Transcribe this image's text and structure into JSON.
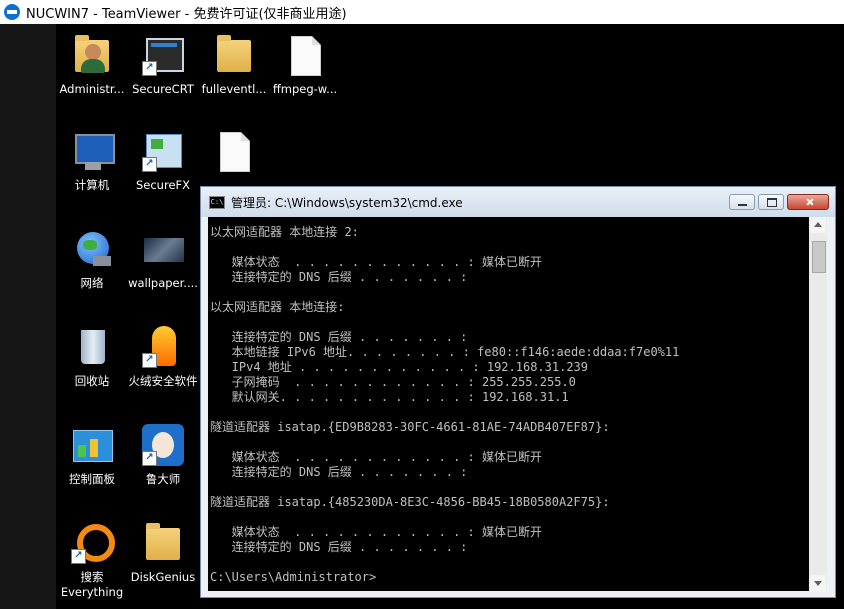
{
  "teamviewer": {
    "title": "NUCWIN7 - TeamViewer - 免费许可证(仅非商业用途)"
  },
  "desktop": {
    "icons": [
      {
        "label": "Administr...",
        "icon": "user-folder-icon"
      },
      {
        "label": "SecureCRT",
        "icon": "securecrt-icon"
      },
      {
        "label": "fulleventl...",
        "icon": "folder-icon"
      },
      {
        "label": "ffmpeg-w...",
        "icon": "document-icon"
      },
      {
        "label": "计算机",
        "icon": "computer-icon"
      },
      {
        "label": "SecureFX",
        "icon": "securefx-icon"
      },
      {
        "label": "",
        "icon": "document-icon"
      },
      {
        "label": "网络",
        "icon": "network-globe-icon"
      },
      {
        "label": "wallpaper....",
        "icon": "wallpaper-image-icon"
      },
      {
        "label": "回收站",
        "icon": "recycle-bin-icon"
      },
      {
        "label": "火绒安全软件",
        "icon": "huorong-icon"
      },
      {
        "label": "控制面板",
        "icon": "control-panel-icon"
      },
      {
        "label": "鲁大师",
        "icon": "ludashi-icon"
      },
      {
        "label": "搜索\nEverything",
        "icon": "everything-search-icon"
      },
      {
        "label": "DiskGenius",
        "icon": "diskgenius-folder-icon"
      }
    ]
  },
  "cmd": {
    "title": "管理员: C:\\Windows\\system32\\cmd.exe",
    "lines": [
      "以太网适配器 本地连接 2:",
      "",
      "   媒体状态  . . . . . . . . . . . . : 媒体已断开",
      "   连接特定的 DNS 后缀 . . . . . . . :",
      "",
      "以太网适配器 本地连接:",
      "",
      "   连接特定的 DNS 后缀 . . . . . . . :",
      "   本地链接 IPv6 地址. . . . . . . . : fe80::f146:aede:ddaa:f7e0%11",
      "   IPv4 地址 . . . . . . . . . . . . : 192.168.31.239",
      "   子网掩码  . . . . . . . . . . . . : 255.255.255.0",
      "   默认网关. . . . . . . . . . . . . : 192.168.31.1",
      "",
      "隧道适配器 isatap.{ED9B8283-30FC-4661-81AE-74ADB407EF87}:",
      "",
      "   媒体状态  . . . . . . . . . . . . : 媒体已断开",
      "   连接特定的 DNS 后缀 . . . . . . . :",
      "",
      "隧道适配器 isatap.{485230DA-8E3C-4856-BB45-18B0580A2F75}:",
      "",
      "   媒体状态  . . . . . . . . . . . . : 媒体已断开",
      "   连接特定的 DNS 后缀 . . . . . . . :",
      "",
      "C:\\Users\\Administrator>"
    ]
  }
}
